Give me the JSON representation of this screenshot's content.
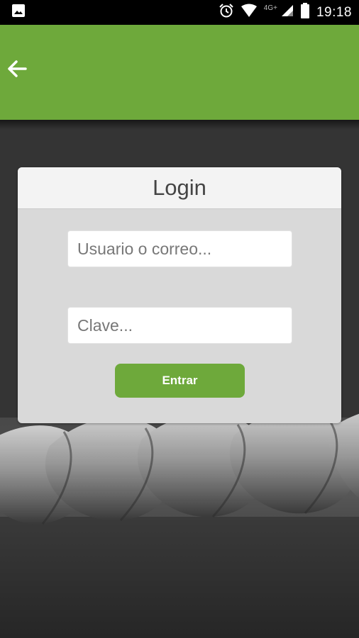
{
  "status_bar": {
    "time": "19:18",
    "network_label": "4G+",
    "icons": [
      "image-icon",
      "alarm-icon",
      "wifi-icon",
      "signal-icon",
      "battery-icon"
    ]
  },
  "app_bar": {
    "back_icon": "arrow-back-icon",
    "color": "#6ea93b"
  },
  "login": {
    "title": "Login",
    "username_placeholder": "Usuario o correo...",
    "username_value": "",
    "password_placeholder": "Clave...",
    "password_value": "",
    "submit_label": "Entrar"
  },
  "colors": {
    "accent": "#6ea93b",
    "card_body": "#d9d9d9",
    "card_header": "#f3f3f3"
  }
}
